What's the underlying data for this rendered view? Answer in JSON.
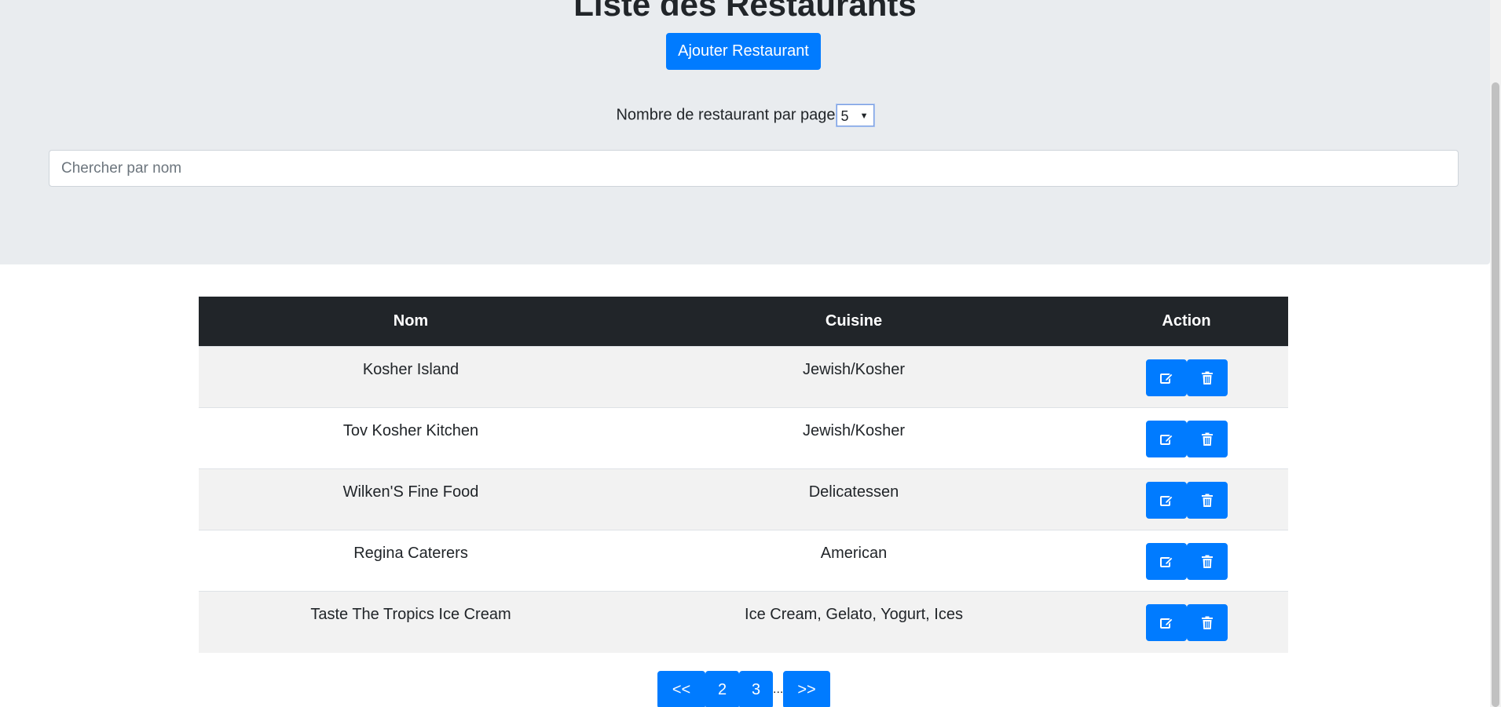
{
  "header": {
    "title": "Liste des Restaurants",
    "add_button_label": "Ajouter Restaurant",
    "per_page_label": "Nombre de restaurant par page",
    "per_page_value": "5",
    "search_placeholder": "Chercher par nom"
  },
  "table": {
    "columns": [
      "Nom",
      "Cuisine",
      "Action"
    ],
    "rows": [
      {
        "nom": "Kosher Island",
        "cuisine": "Jewish/Kosher"
      },
      {
        "nom": "Tov Kosher Kitchen",
        "cuisine": "Jewish/Kosher"
      },
      {
        "nom": "Wilken'S Fine Food",
        "cuisine": "Delicatessen"
      },
      {
        "nom": "Regina Caterers",
        "cuisine": "American"
      },
      {
        "nom": "Taste The Tropics Ice Cream",
        "cuisine": "Ice Cream, Gelato, Yogurt, Ices"
      }
    ],
    "row_actions": [
      "edit-icon",
      "trash-icon"
    ]
  },
  "pagination": {
    "prev_label": "<<",
    "pages": [
      "2",
      "3"
    ],
    "ellipsis": "...",
    "next_label": ">>"
  },
  "colors": {
    "primary": "#007bff",
    "table_header": "#212529",
    "jumbotron": "#e9ecef"
  }
}
